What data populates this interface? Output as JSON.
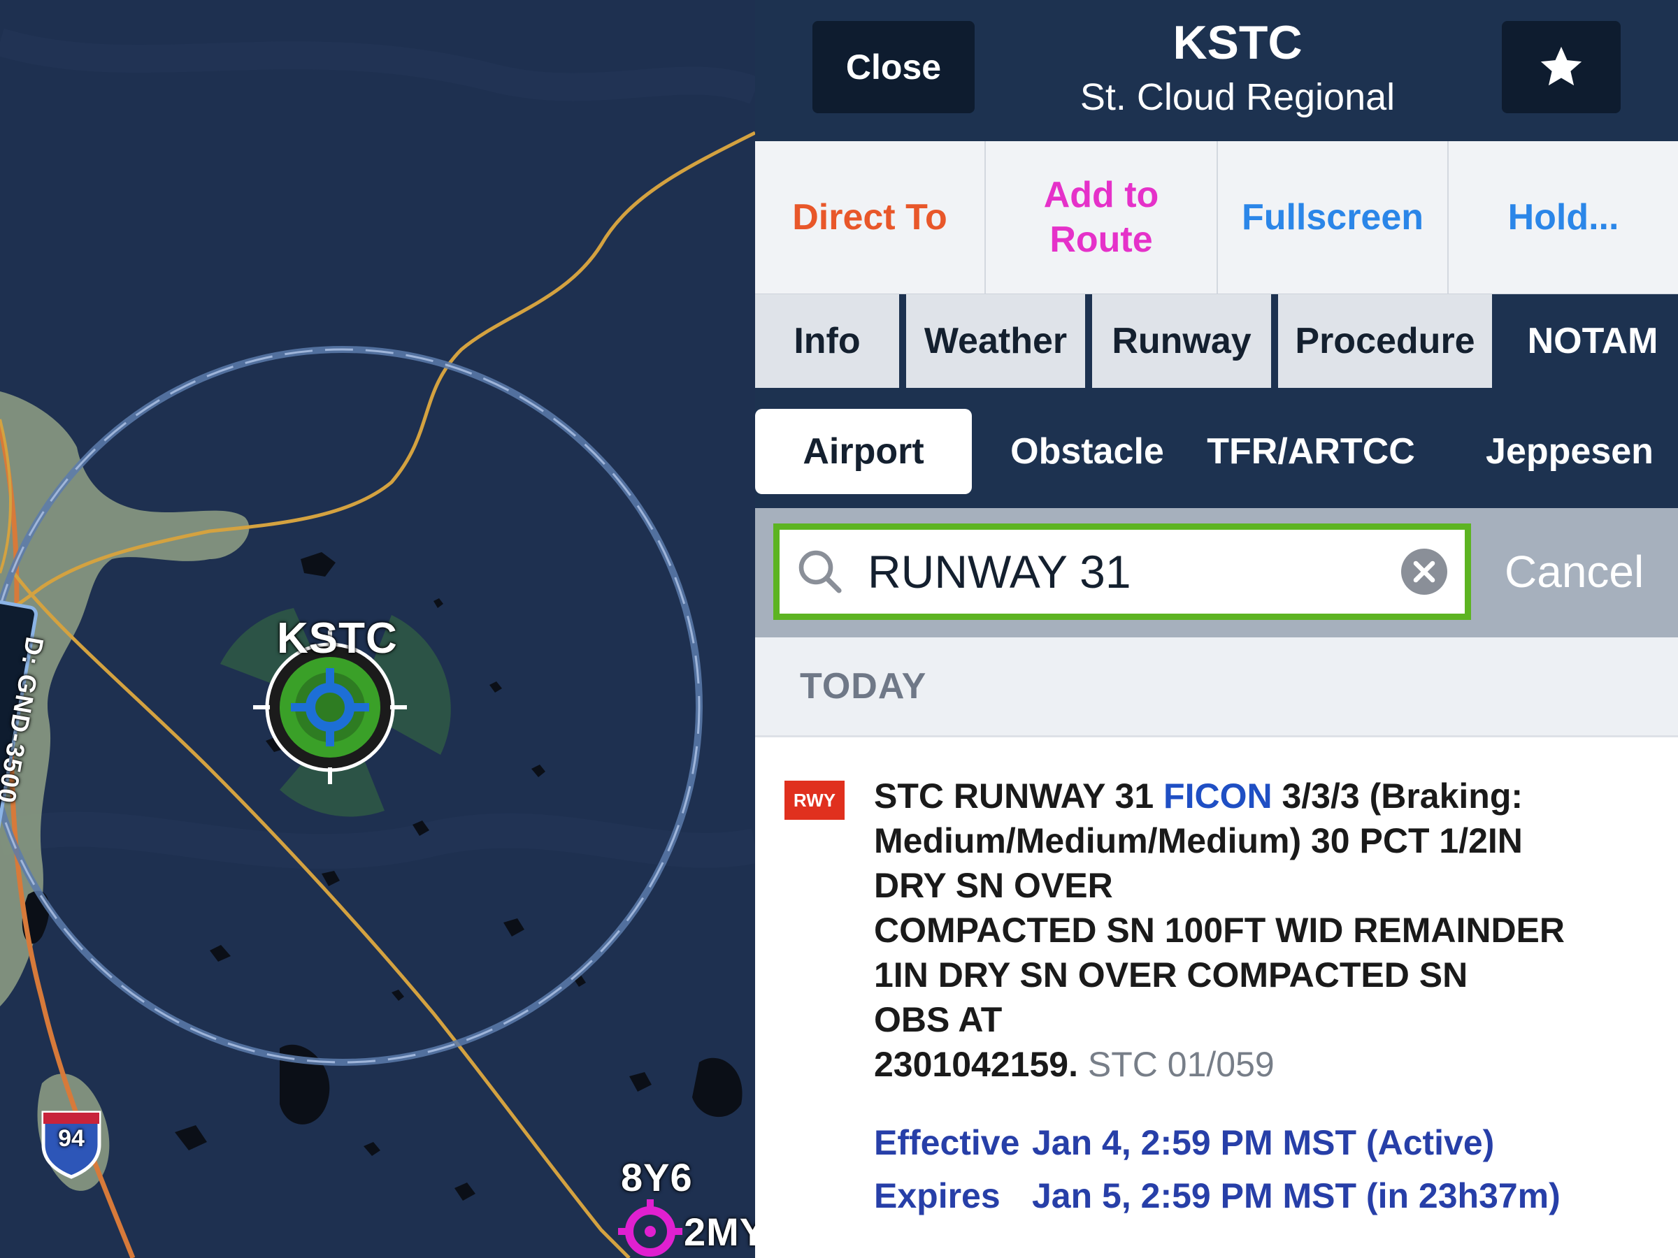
{
  "map": {
    "airport_label": "KSTC",
    "nearby_airport_1": "8Y6",
    "nearby_airport_2": "2MY",
    "highway_shield": "94",
    "airspace_label": "D: GND-3500",
    "colors": {
      "map_bg": "#1e3050",
      "land": "#8c9b83",
      "route": "#d4a240",
      "airspace": "#6d8ab8",
      "airport_green": "#3aa028",
      "airport_blue": "#1d6fd6",
      "magenta": "#e020d0"
    }
  },
  "header": {
    "close_label": "Close",
    "airport_code": "KSTC",
    "airport_name": "St. Cloud Regional",
    "favorite_icon": "star-icon"
  },
  "actions": [
    {
      "label": "Direct To",
      "color": "#e8572a"
    },
    {
      "label": "Add to Route",
      "color": "#e531c9"
    },
    {
      "label": "Fullscreen",
      "color": "#2b86e8"
    },
    {
      "label": "Hold...",
      "color": "#2b86e8"
    }
  ],
  "tabs": [
    "Info",
    "Weather",
    "Runway",
    "Procedure",
    "NOTAM"
  ],
  "active_tab": "NOTAM",
  "subtabs": [
    "Airport",
    "Obstacle",
    "TFR/ARTCC",
    "Jeppesen"
  ],
  "active_subtab": "Airport",
  "search": {
    "value": "RUNWAY 31",
    "cancel_label": "Cancel",
    "highlight_color": "#5db422"
  },
  "section_header": "TODAY",
  "notam": {
    "badge": "RWY",
    "prefix": "STC RUNWAY 31",
    "keyword": "FICON",
    "text_line1": "3/3/3 (Braking:",
    "text_line2": "Medium/Medium/Medium) 30 PCT 1/2IN",
    "text_line3": "DRY SN OVER",
    "text_line4": "COMPACTED SN 100FT WID REMAINDER",
    "text_line5": "1IN DRY SN OVER COMPACTED SN",
    "text_line6": "OBS AT",
    "text_line7": "2301042159.",
    "id": "STC 01/059",
    "effective_label": "Effective",
    "effective_value": "Jan 4, 2:59 PM MST (Active)",
    "expires_label": "Expires",
    "expires_value": "Jan 5, 2:59 PM MST (in 23h37m)"
  }
}
